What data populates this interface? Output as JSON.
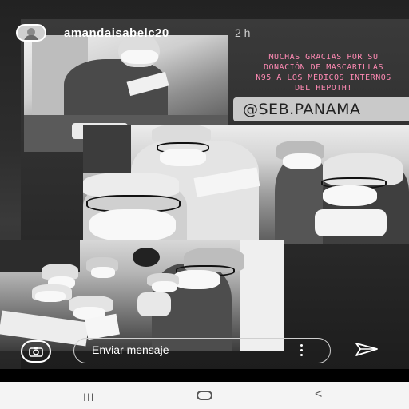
{
  "story": {
    "username": "amandaisabelc20",
    "time": "2 h",
    "caption_lines": [
      "MUCHAS GRACIAS POR SU",
      "DONACIÓN DE MASCARILLAS",
      "N95 A LOS MÉDICOS INTERNOS",
      "DEL HEPOTH!"
    ],
    "mention_tag": "@SEB.PANAMA"
  },
  "reply": {
    "placeholder": "Enviar mensaje"
  },
  "icons": {
    "camera": "camera-icon",
    "more": "more-vertical-icon",
    "send": "send-icon",
    "recents": "recents-icon",
    "home": "home-icon",
    "back": "back-icon"
  },
  "navbar": {
    "recents_glyph": "III",
    "back_glyph": "<"
  },
  "colors": {
    "caption": "#ff8ab4",
    "tag_bg": "#c9c9c9"
  }
}
